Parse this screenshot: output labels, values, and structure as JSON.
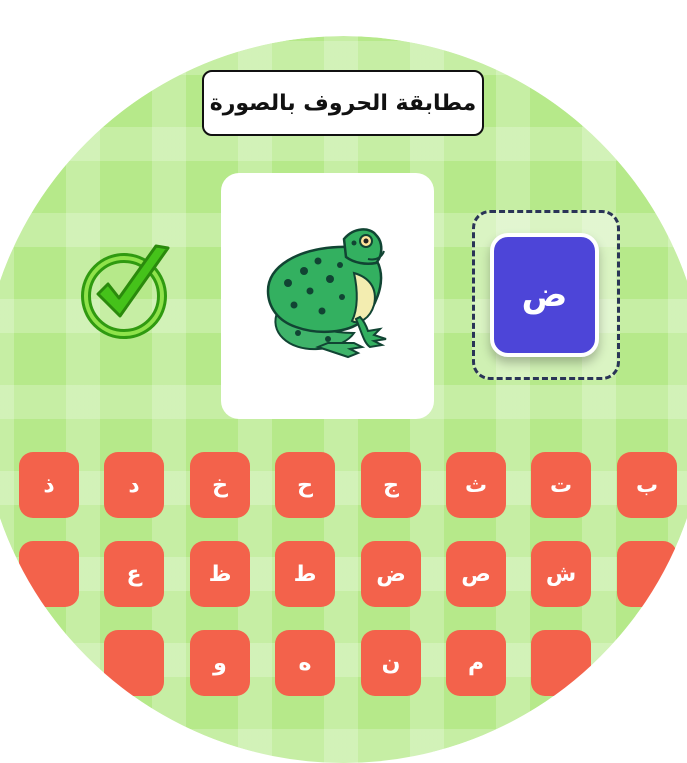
{
  "game": {
    "title": "مطابقة الحروف بالصورة",
    "status_icon": "checkmark-icon",
    "picture_icon": "frog-image",
    "target_letter": "ض",
    "colors": {
      "background": "#b6e98a",
      "key": "#f3624b",
      "target_tile": "#4d45d8",
      "check": "#3fb414"
    }
  },
  "keyboard": {
    "row1": [
      "ب",
      "ت",
      "ث",
      "ج",
      "ح",
      "خ",
      "د",
      "ذ"
    ],
    "row2": [
      "",
      "ش",
      "ص",
      "ض",
      "ط",
      "ظ",
      "ع",
      ""
    ],
    "row3": [
      "",
      "م",
      "ن",
      "ه",
      "و",
      ""
    ]
  }
}
